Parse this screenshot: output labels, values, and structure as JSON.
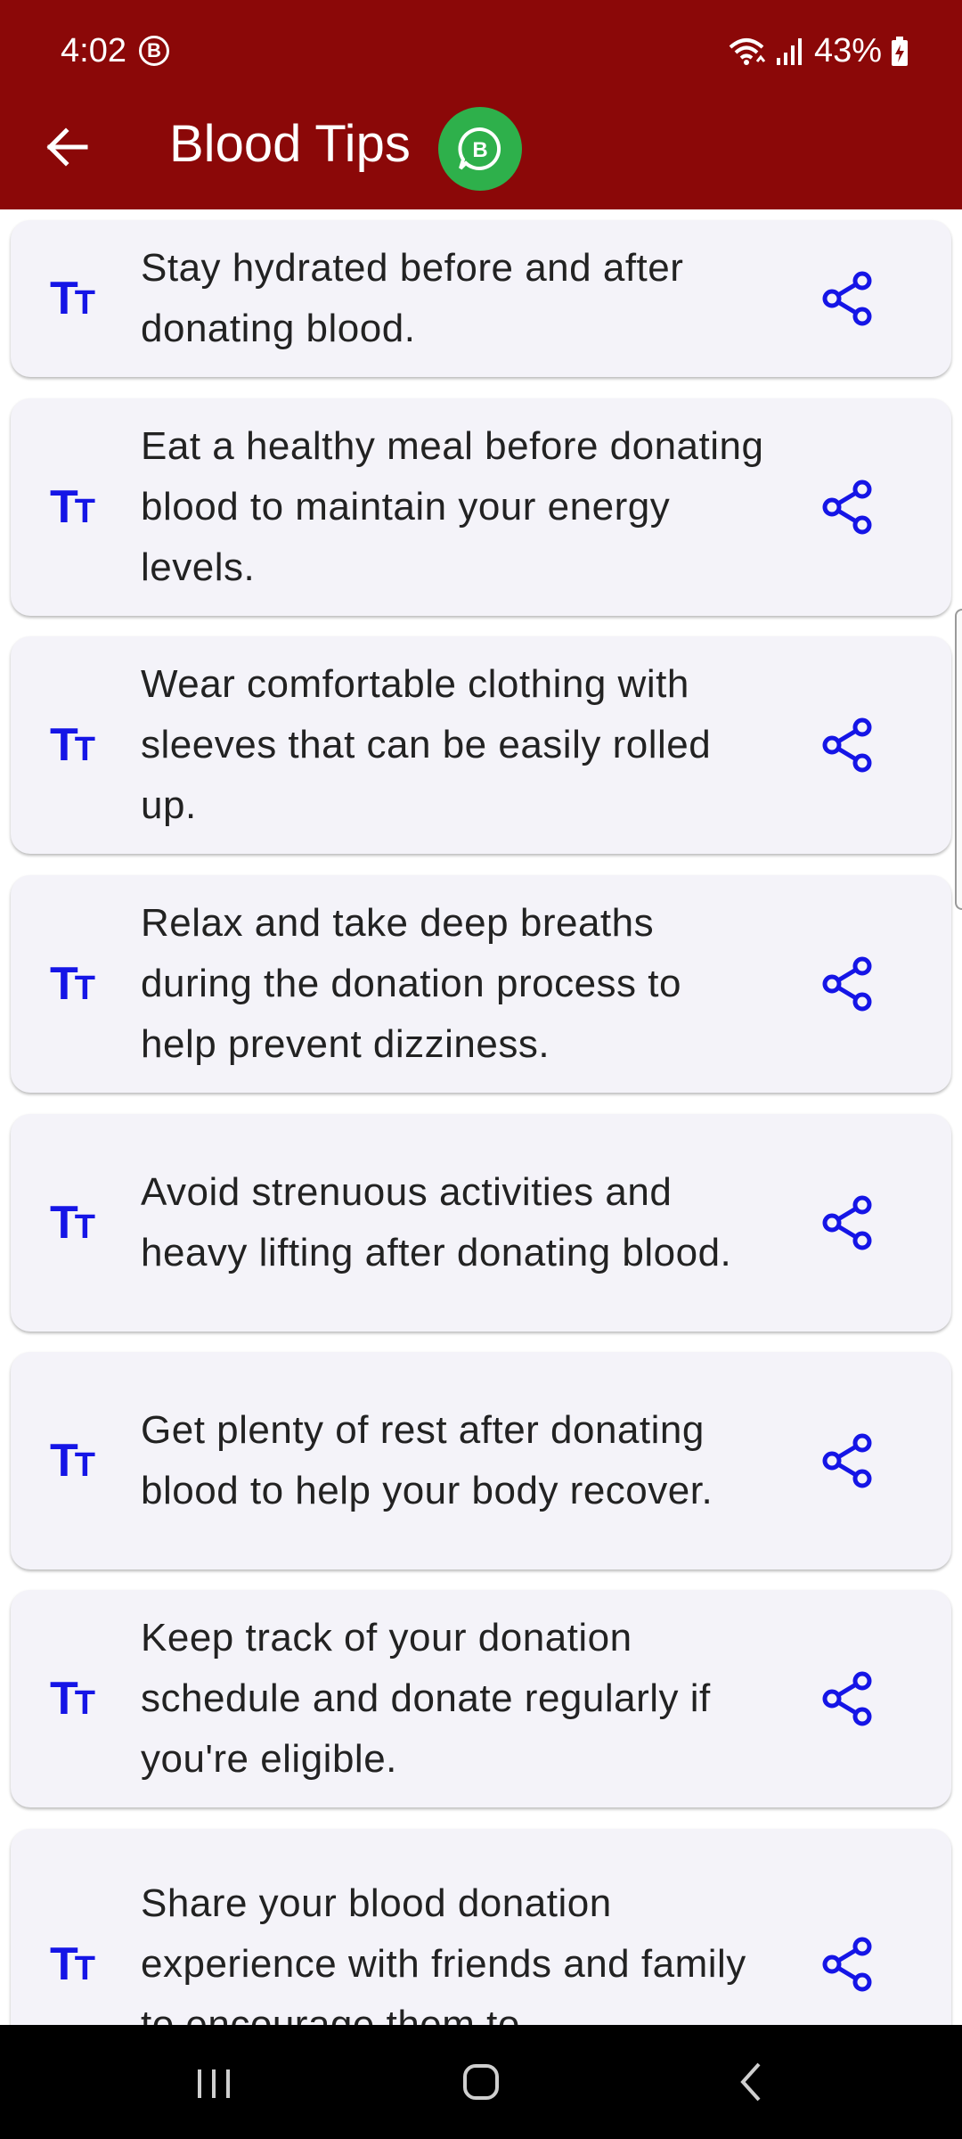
{
  "status_bar": {
    "time": "4:02",
    "notification_badge": "B",
    "battery": "43%"
  },
  "app_bar": {
    "title": "Blood Tips",
    "back_icon": "arrow-left-icon",
    "badge_icon": "whatsapp-business-icon",
    "badge_letter": "B",
    "colors": {
      "background": "#8b0808",
      "badge": "#2eb04b"
    }
  },
  "tips": [
    {
      "text": "Stay hydrated before and after donating blood."
    },
    {
      "text": "Eat a healthy meal before donating blood to maintain your energy levels."
    },
    {
      "text": "Wear comfortable clothing with sleeves that can be easily rolled up."
    },
    {
      "text": "Relax and take deep breaths during the donation process to help prevent dizziness."
    },
    {
      "text": "Avoid strenuous activities and heavy lifting after donating blood."
    },
    {
      "text": "Get plenty of rest after donating blood to help your body recover."
    },
    {
      "text": "Keep track of your donation schedule and donate regularly if you're eligible."
    },
    {
      "text": "Share your blood donation experience with friends and family to encourage them to"
    }
  ],
  "tip_icons": {
    "text_icon": "text-size-icon",
    "share_icon": "share-icon",
    "accent": "#1515e6"
  },
  "nav_bar": {
    "recent": "recent-apps-icon",
    "home": "home-icon",
    "back": "back-icon"
  }
}
